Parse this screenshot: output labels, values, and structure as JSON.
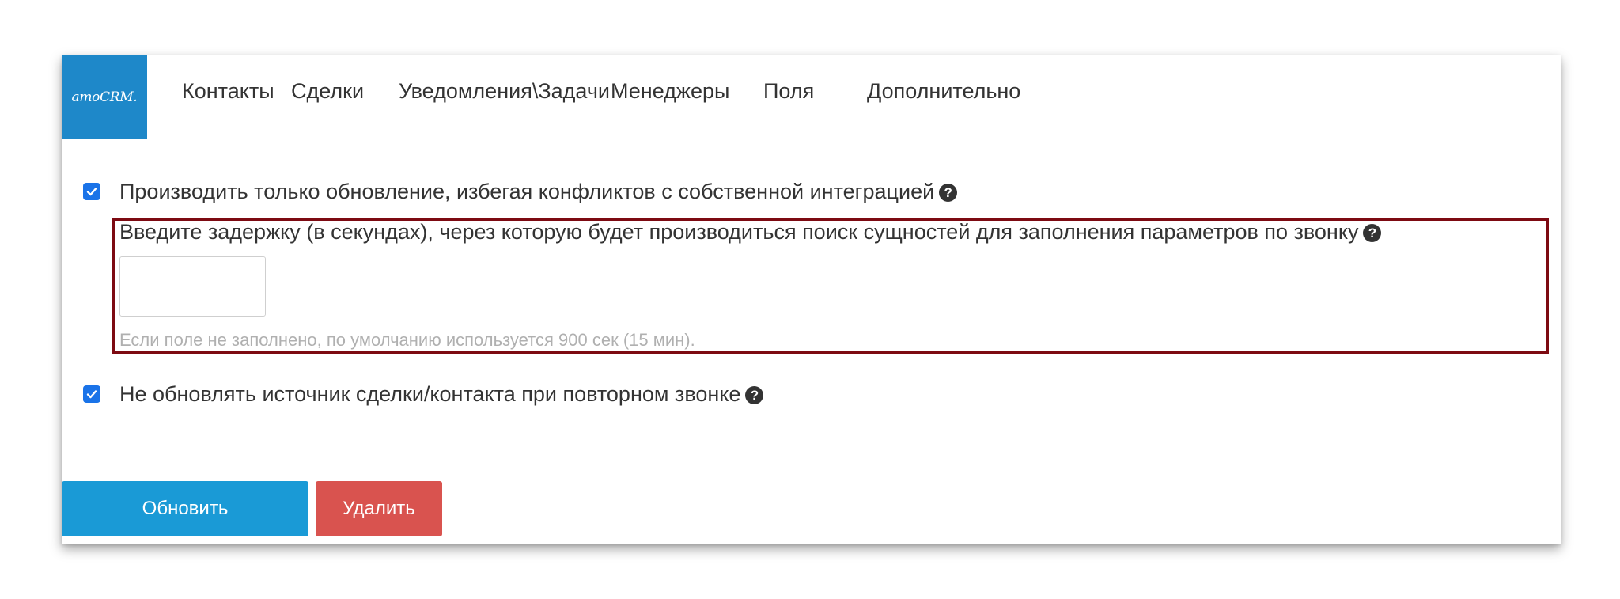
{
  "nav": {
    "logo_text": "amoCRM.",
    "tabs": [
      {
        "label": "Контакты"
      },
      {
        "label": "Сделки"
      },
      {
        "label": "Уведомления\\Задачи"
      },
      {
        "label": "Менеджеры"
      },
      {
        "label": "Поля"
      },
      {
        "label": "Дополнительно"
      }
    ]
  },
  "options": {
    "update_only": {
      "checked": true,
      "label": "Производить только обновление, избегая конфликтов с собственной интеграцией"
    },
    "delay": {
      "label": "Введите задержку (в секундах), через которую будет производиться поиск сущностей для заполнения параметров по звонку",
      "value": "",
      "placeholder": "",
      "hint": "Если поле не заполнено, по умолчанию используется 900 сек (15 мин)."
    },
    "no_source_update": {
      "checked": true,
      "label": "Не обновлять источник сделки/контакта при повторном звонке"
    }
  },
  "help_icon_glyph": "?",
  "buttons": {
    "update_label": "Обновить",
    "delete_label": "Удалить"
  },
  "colors": {
    "logo_bg": "#1e88c9",
    "update_button": "#1a9ad6",
    "delete_button": "#d9534f",
    "highlight_border": "#7d0a12",
    "checkbox": "#1a73e8"
  }
}
